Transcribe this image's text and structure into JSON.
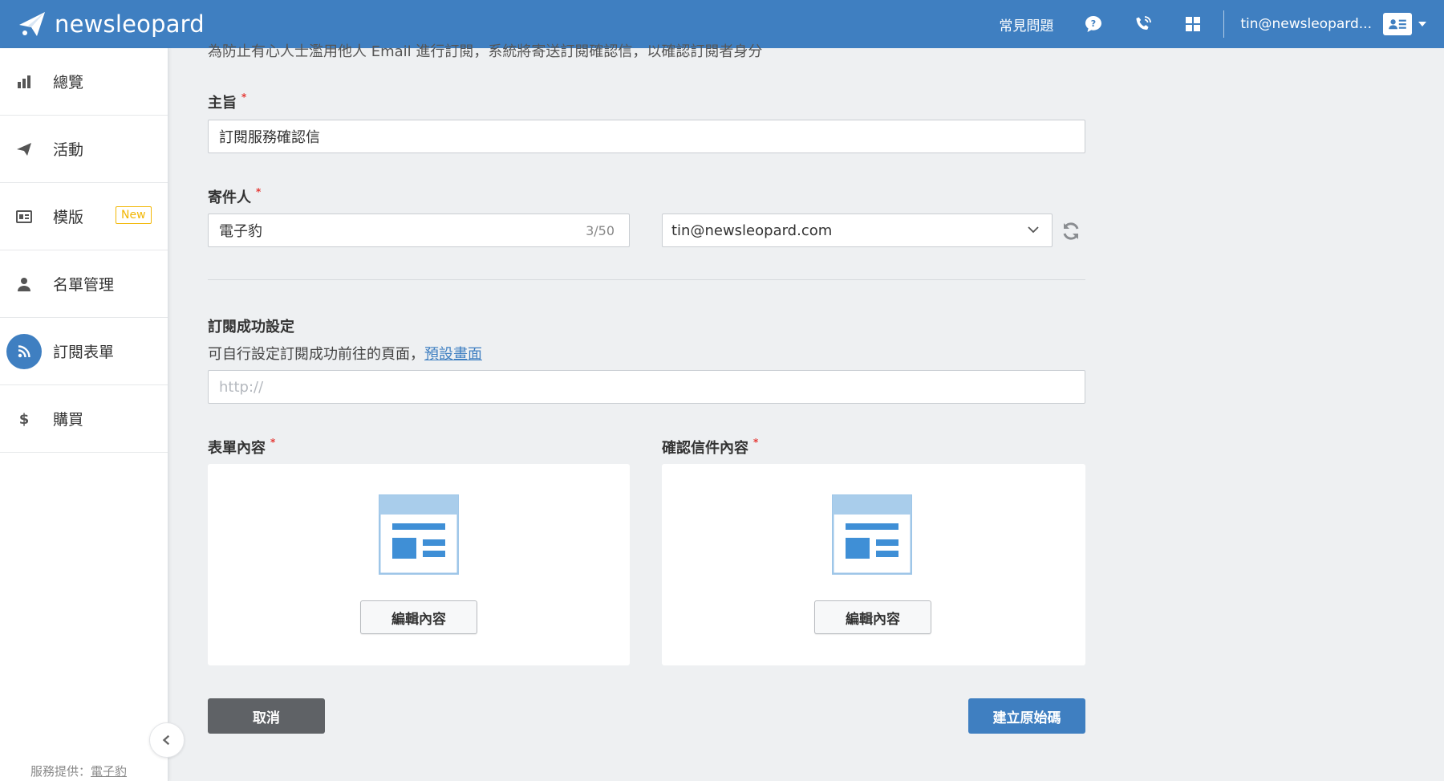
{
  "topbar": {
    "brand": "newsleopard",
    "faq": "常見問題",
    "user_email": "tin@newsleopard...",
    "icons": [
      "chat-icon",
      "phone-icon",
      "apps-grid-icon",
      "contact-card-icon"
    ]
  },
  "sidebar": {
    "items": [
      {
        "label": "總覽",
        "icon": "bar-chart-icon"
      },
      {
        "label": "活動",
        "icon": "paper-plane-icon"
      },
      {
        "label": "模版",
        "icon": "template-icon",
        "badge": "New"
      },
      {
        "label": "名單管理",
        "icon": "user-icon"
      },
      {
        "label": "訂閱表單",
        "icon": "rss-icon",
        "active": true
      },
      {
        "label": "購買",
        "icon": "dollar-icon"
      }
    ],
    "footer_prefix": "服務提供：",
    "footer_link": "電子豹"
  },
  "main": {
    "intro": "為防止有心人士濫用他人 Email 進行訂閱，系統將寄送訂閱確認信，以確認訂閱者身分",
    "subject": {
      "label": "主旨",
      "required": "*",
      "value": "訂閱服務確認信"
    },
    "sender": {
      "label": "寄件人",
      "required": "*",
      "name_value": "電子豹",
      "counter": "3/50",
      "email_value": "tin@newsleopard.com"
    },
    "success": {
      "label": "訂閱成功設定",
      "desc": "可自行設定訂閱成功前往的頁面，",
      "link": "預設畫面",
      "url_placeholder": "http://"
    },
    "form_content": {
      "label": "表單內容",
      "required": "*",
      "edit_label": "編輯內容"
    },
    "confirm_content": {
      "label": "確認信件內容",
      "required": "*",
      "edit_label": "編輯內容"
    },
    "cancel_label": "取消",
    "create_label": "建立原始碼"
  },
  "colors": {
    "brand_blue": "#3f7fc1",
    "badge_yellow": "#f2b705",
    "cancel_gray": "#5f6266",
    "required_red": "#e53935"
  }
}
